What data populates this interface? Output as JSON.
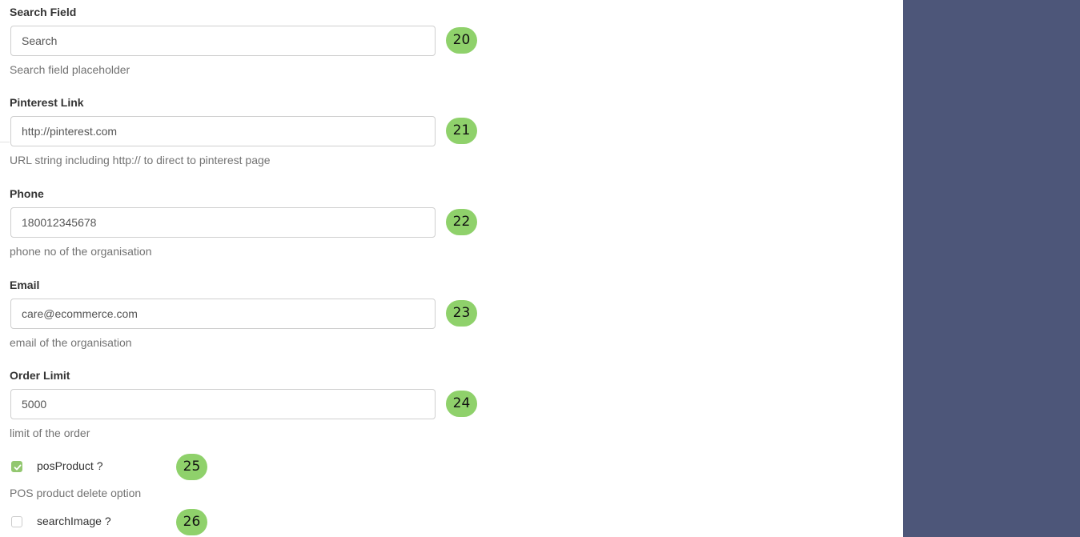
{
  "colors": {
    "sidebar_bg": "#4d5679",
    "badge_bg": "#8fd16b",
    "checkbox_checked_bg": "#93c770"
  },
  "fields": [
    {
      "label": "Search Field",
      "value": "Search",
      "help": "Search field placeholder",
      "badge": "20"
    },
    {
      "label": "Pinterest Link",
      "value": "http://pinterest.com",
      "help": "URL string including http:// to direct to pinterest page",
      "badge": "21"
    },
    {
      "label": "Phone",
      "value": "180012345678",
      "help": "phone no of the organisation",
      "badge": "22"
    },
    {
      "label": "Email",
      "value": "care@ecommerce.com",
      "help": "email of the organisation",
      "badge": "23"
    },
    {
      "label": "Order Limit",
      "value": "5000",
      "help": "limit of the order",
      "badge": "24"
    }
  ],
  "checkboxes": [
    {
      "label": "posProduct ?",
      "checked": true,
      "help": "POS product delete option",
      "badge": "25"
    },
    {
      "label": "searchImage ?",
      "checked": false,
      "badge": "26"
    }
  ],
  "icons": {
    "checkmark": "check-icon"
  }
}
